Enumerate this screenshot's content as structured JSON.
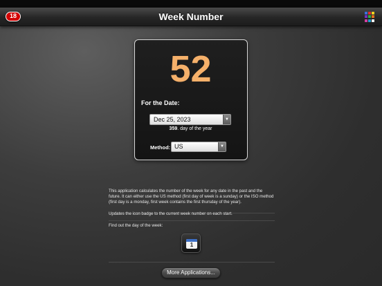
{
  "navbar": {
    "badge_count": "18",
    "title": "Week Number",
    "grid_icon_colors": [
      "#3b6fd8",
      "#e03030",
      "#f0d020",
      "#7030c0",
      "#30b040",
      "#e07020",
      "#d040a0",
      "#20a0d0",
      "#f0f0f0"
    ]
  },
  "card": {
    "week_number": "52",
    "for_date_label": "For the Date:",
    "date_value": "Dec 25, 2023",
    "day_of_year_number": "359",
    "day_of_year_suffix": ". day of the year",
    "method_label": "Method:",
    "method_value": "US",
    "accent_color": "#f5b06a"
  },
  "info": {
    "description": "This application calculates the number of the week for any date in the past and the future. It can either use the US method (first day of week is a sunday) or the ISO method (first day is a monday, first week contains the first thursday of the year).",
    "badge_note": "Updates the icon badge to the current week number on each start.",
    "find_day_label": "Find out the day of the week:",
    "calendar_app_day": "1"
  },
  "more_button_label": "More Applications..."
}
